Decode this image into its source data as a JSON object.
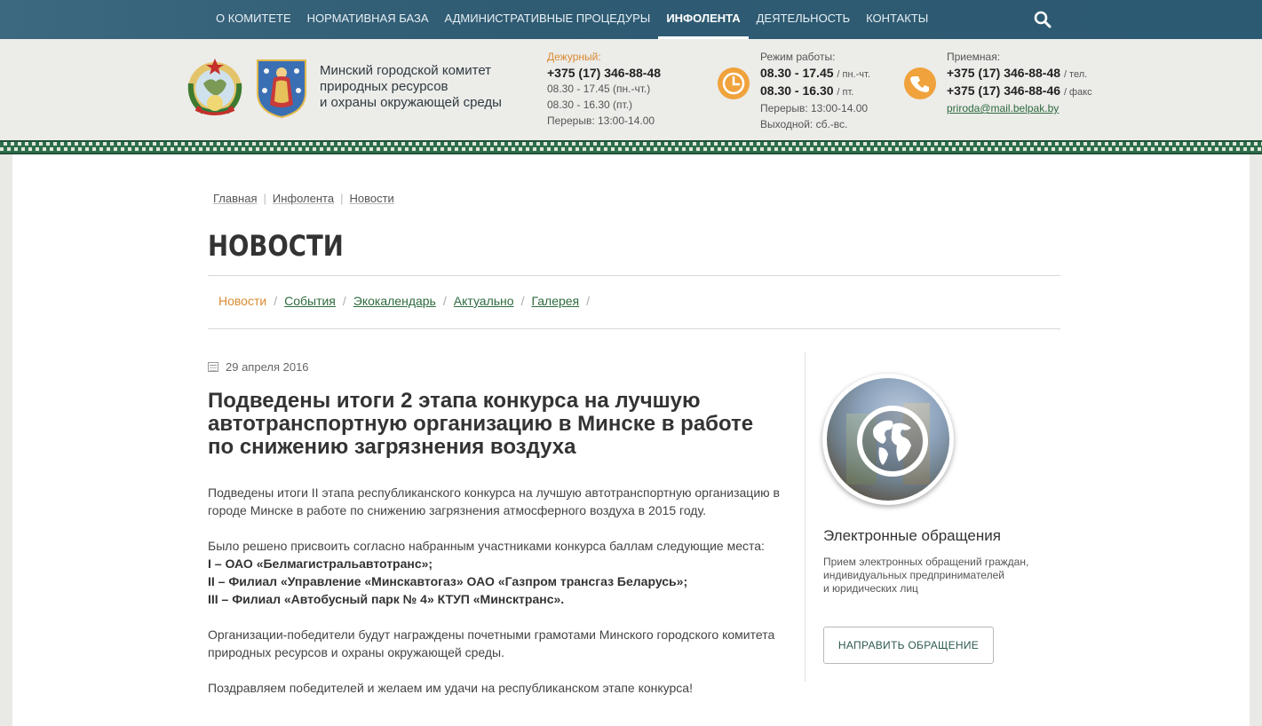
{
  "topnav": {
    "items": [
      {
        "label": "О КОМИТЕТЕ"
      },
      {
        "label": "НОРМАТИВНАЯ БАЗА"
      },
      {
        "label": "АДМИНИСТРАТИВНЫЕ ПРОЦЕДУРЫ"
      },
      {
        "label": "ИНФОЛЕНТА",
        "active": true
      },
      {
        "label": "ДЕЯТЕЛЬНОСТЬ"
      },
      {
        "label": "КОНТАКТЫ"
      }
    ],
    "search_icon": "search-icon"
  },
  "header": {
    "org_line1": "Минский городской комитет",
    "org_line2": "природных ресурсов",
    "org_line3": "и охраны окружающей среды",
    "duty": {
      "label": "Дежурный:",
      "phone": "+375 (17) 346-88-48",
      "line1": "08.30 - 17.45 (пн.-чт.)",
      "line2": "08.30 - 16.30 (пт.)",
      "line3": "Перерыв: 13:00-14.00"
    },
    "hours": {
      "label": "Режим работы:",
      "row1_time": "08.30 - 17.45",
      "row1_days": "/ пн.-чт.",
      "row2_time": "08.30 - 16.30",
      "row2_days": "/ пт.",
      "break": "Перерыв: 13:00-14.00",
      "dayoff": "Выходной: сб.-вс."
    },
    "reception": {
      "label": "Приемная:",
      "phone1": "+375 (17) 346-88-48",
      "phone1_type": "/ тел.",
      "phone2": "+375 (17) 346-88-46",
      "phone2_type": "/ факс",
      "email": "priroda@mail.belpak.by"
    },
    "accent_color": "#f0a23c",
    "nav_color": "#2f5b73"
  },
  "breadcrumb": [
    "Главная",
    "Инфолента",
    "Новости"
  ],
  "page_title": "НОВОСТИ",
  "subnav": {
    "current": "Новости",
    "items": [
      "События",
      "Экокалендарь",
      "Актуально",
      "Галерея"
    ]
  },
  "article": {
    "date": "29 апреля 2016",
    "title": "Подведены итоги 2 этапа конкурса на лучшую автотранспортную организацию в Минске в работе по снижению загрязнения воздуха",
    "p1": "Подведены итоги II этапа республиканского конкурса на лучшую автотранспортную организацию в городе Минске в работе по снижению загрязнения атмосферного воздуха в 2015 году.",
    "p2_intro": "Было решено присвоить согласно набранным участниками конкурса баллам следующие места:",
    "place1": "I – ОАО «Белмагистральавтотранс»;",
    "place2": "II – Филиал «Управление «Минскавтогаз» ОАО «Газпром трансгаз Беларусь»;",
    "place3": "III – Филиал «Автобусный парк № 4» КТУП «Минсктранс».",
    "p3": "Организации-победители будут награждены почетными грамотами Минского городского комитета природных ресурсов и охраны окружающей среды.",
    "p4": "Поздравляем победителей и желаем им удачи на республиканском этапе конкурса!"
  },
  "sidebar": {
    "title": "Электронные обращения",
    "desc1": "Прием электронных обращений граждан,",
    "desc2": "индивидуальных предпринимателей",
    "desc3": "и юридических лиц",
    "button": "НАПРАВИТЬ ОБРАЩЕНИЕ"
  }
}
